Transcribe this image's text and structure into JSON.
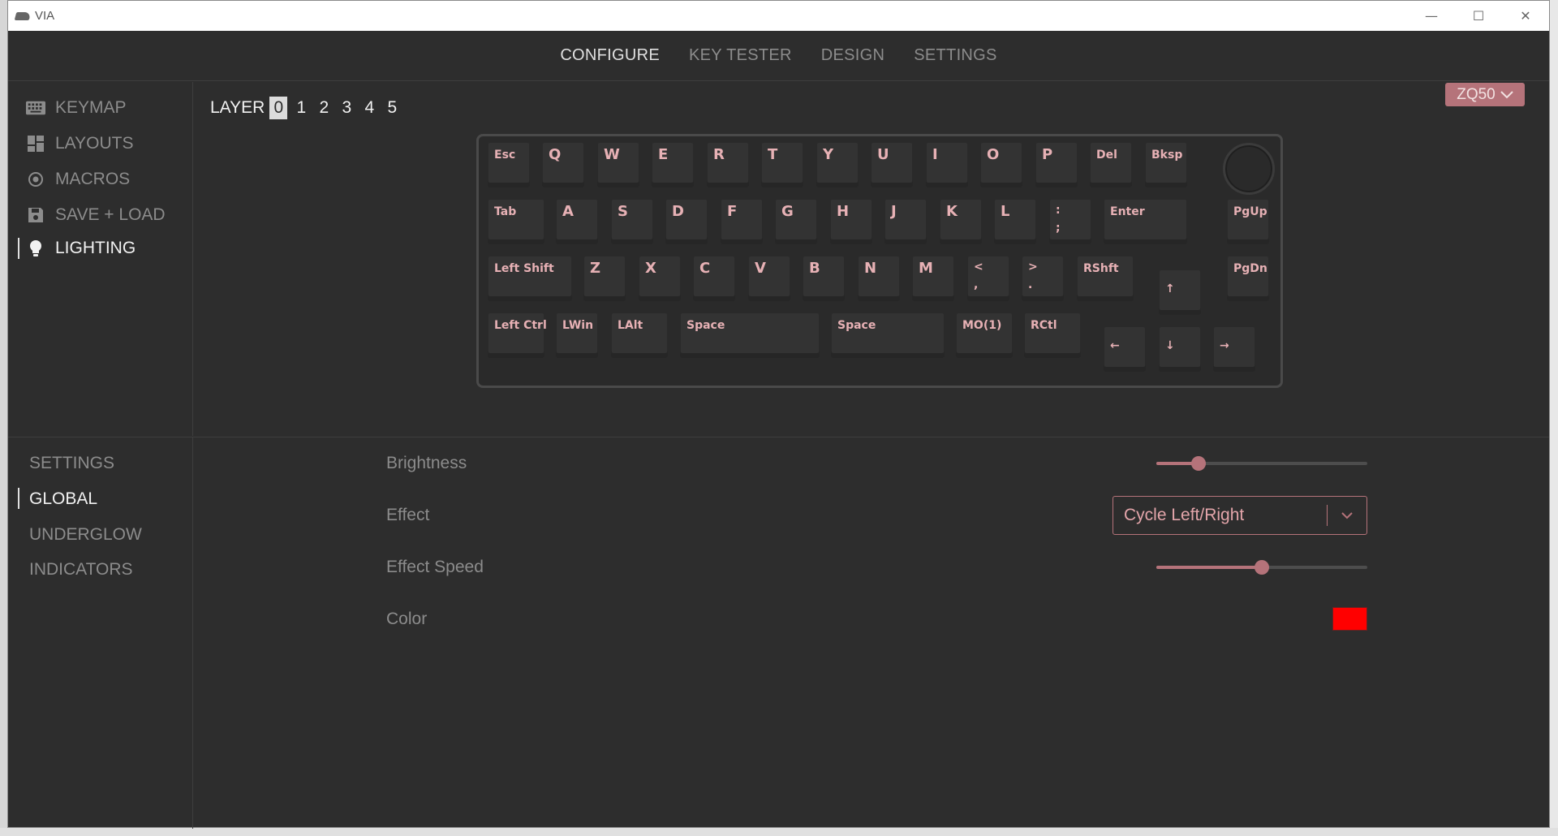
{
  "window": {
    "title": "VIA",
    "controls": {
      "minimize": "—",
      "maximize": "☐",
      "close": "✕"
    }
  },
  "topnav": [
    {
      "label": "CONFIGURE",
      "active": true
    },
    {
      "label": "KEY TESTER",
      "active": false
    },
    {
      "label": "DESIGN",
      "active": false
    },
    {
      "label": "SETTINGS",
      "active": false
    }
  ],
  "sidebar": {
    "items": [
      {
        "label": "KEYMAP",
        "icon": "keyboard-icon"
      },
      {
        "label": "LAYOUTS",
        "icon": "layouts-icon"
      },
      {
        "label": "MACROS",
        "icon": "macros-icon"
      },
      {
        "label": "SAVE + LOAD",
        "icon": "save-icon"
      },
      {
        "label": "LIGHTING",
        "icon": "bulb-icon",
        "active": true
      }
    ]
  },
  "layer": {
    "label": "LAYER",
    "numbers": [
      "0",
      "1",
      "2",
      "3",
      "4",
      "5"
    ],
    "active": "0"
  },
  "device": {
    "name": "ZQ50"
  },
  "keys": {
    "esc": "Esc",
    "q": "Q",
    "w": "W",
    "e": "E",
    "r": "R",
    "t": "T",
    "y": "Y",
    "u": "U",
    "i": "I",
    "o": "O",
    "p": "P",
    "del": "Del",
    "bksp": "Bksp",
    "tab": "Tab",
    "a": "A",
    "s": "S",
    "d": "D",
    "f": "F",
    "g": "G",
    "h": "H",
    "j": "J",
    "k": "K",
    "l": "L",
    "semicolon_top": ":",
    "semicolon_bottom": ";",
    "enter": "Enter",
    "pgup": "PgUp",
    "lshift": "Left Shift",
    "z": "Z",
    "x": "X",
    "c": "C",
    "v": "V",
    "b": "B",
    "n": "N",
    "m": "M",
    "comma_top": "<",
    "comma_bottom": ",",
    "period_top": ">",
    "period_bottom": ".",
    "rshift": "RShft",
    "up": "↑",
    "pgdn": "PgDn",
    "lctrl": "Left Ctrl",
    "lwin": "LWin",
    "lalt": "LAlt",
    "space1": "Space",
    "space2": "Space",
    "mo1": "MO(1)",
    "rctl": "RCtl",
    "left": "←",
    "down": "↓",
    "right": "→"
  },
  "lighting": {
    "tabs": [
      {
        "label": "SETTINGS"
      },
      {
        "label": "GLOBAL",
        "active": true
      },
      {
        "label": "UNDERGLOW"
      },
      {
        "label": "INDICATORS"
      }
    ],
    "brightness": {
      "label": "Brightness",
      "value": 0.2
    },
    "effect": {
      "label": "Effect",
      "value": "Cycle Left/Right"
    },
    "effect_speed": {
      "label": "Effect Speed",
      "value": 0.5
    },
    "color": {
      "label": "Color",
      "value": "#ff0000"
    }
  },
  "colors": {
    "accent": "#b5737a",
    "key_legend": "#e7b1b5"
  }
}
